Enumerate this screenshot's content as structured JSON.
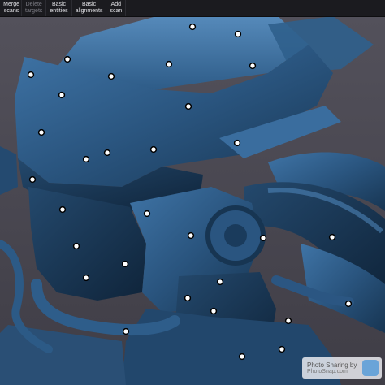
{
  "toolbar": {
    "buttons": [
      {
        "label": "Merge\nscans",
        "enabled": true
      },
      {
        "label": "Delete\ntargets",
        "enabled": false
      },
      {
        "label": "Basic\nentities",
        "enabled": true
      },
      {
        "label": "Basic\nalignments",
        "enabled": true
      },
      {
        "label": "Add\nscan",
        "enabled": true
      }
    ]
  },
  "viewport": {
    "background_color": "#4a4852",
    "scan_color": "#2d5a86",
    "target_marker_color": "#ffffff"
  },
  "watermark": {
    "line1": "Photo Sharing by",
    "line2": "PhotoSnap.com"
  }
}
